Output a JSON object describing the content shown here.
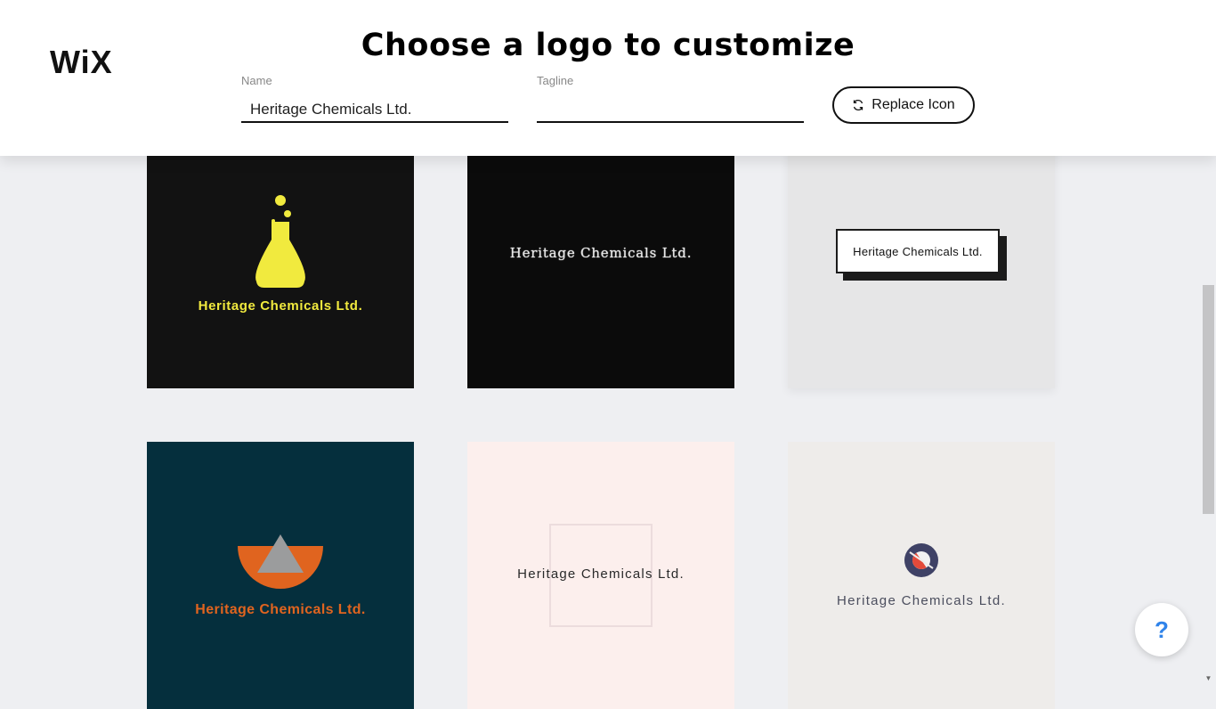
{
  "header": {
    "brand": "WiX",
    "title": "Choose a logo to customize",
    "name_field": {
      "label": "Name",
      "value": "Heritage Chemicals Ltd."
    },
    "tagline_field": {
      "label": "Tagline",
      "value": ""
    },
    "replace_icon_label": "Replace Icon"
  },
  "logos": [
    {
      "text": "Heritage Chemicals Ltd.",
      "style": "flask-yellow-on-black",
      "background": "#121212",
      "accent": "#f1ea3e"
    },
    {
      "text": "Heritage Chemicals Ltd.",
      "style": "serif-outline-on-black",
      "background": "#0b0b0b",
      "accent": "#e8e8e8"
    },
    {
      "text": "Heritage Chemicals Ltd.",
      "style": "boxed-shadow-on-grey",
      "background": "#e6e6e7",
      "accent": "#1b1b1b"
    },
    {
      "text": "Heritage Chemicals Ltd.",
      "style": "orange-bowl-triangle-on-teal",
      "background": "#052f3d",
      "accent": "#e0641f"
    },
    {
      "text": "Heritage Chemicals Ltd.",
      "style": "frame-on-pink",
      "background": "#fcefed",
      "accent": "#2a2a2a"
    },
    {
      "text": "Heritage Chemicals Ltd.",
      "style": "ring-icon-on-cream",
      "background": "#eeecea",
      "accent": "#3f4266"
    }
  ],
  "help_button": {
    "label": "?"
  }
}
